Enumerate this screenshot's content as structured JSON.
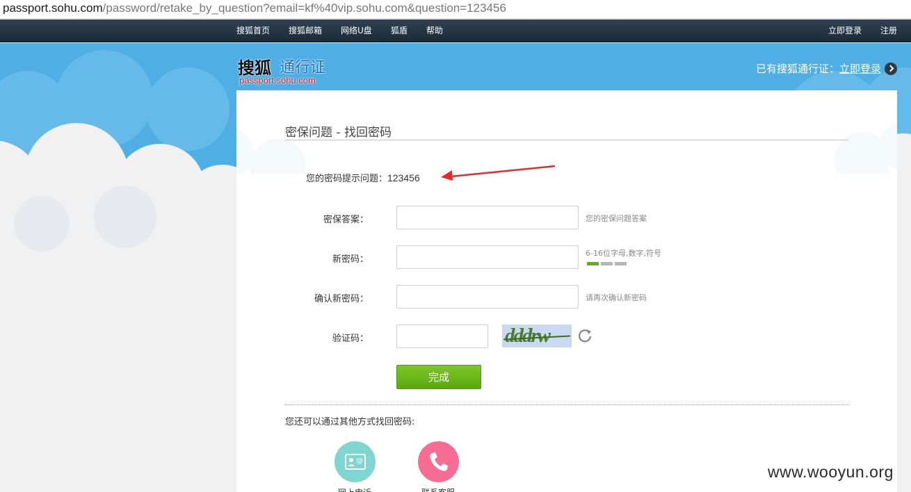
{
  "browser": {
    "url_host": "passport.sohu.com",
    "url_path": "/password/retake_by_question?email=kf%40vip.sohu.com&question=123456"
  },
  "topnav": {
    "left_items": [
      "搜狐首页",
      "搜狐邮箱",
      "网络U盘",
      "狐盾",
      "帮助"
    ],
    "login": "立即登录",
    "register": "注册"
  },
  "header": {
    "logo_cn_1": "搜狐",
    "logo_cn_2": "通行证",
    "logo_en": "passport.sohu.com",
    "has_account": "已有搜狐通行证：",
    "login_link": "立即登录"
  },
  "form": {
    "title": "密保问题 - 找回密码",
    "hint_label": "您的密码提示问题：",
    "hint_question": "123456",
    "answer_label": "密保答案：",
    "answer_tip": "您的密保问题答案",
    "answer_value": "",
    "new_password_label": "新密码：",
    "new_password_tip": "6-16位字母,数字,符号",
    "new_password_value": "",
    "confirm_label": "确认新密码：",
    "confirm_tip": "请再次确认新密码",
    "confirm_value": "",
    "captcha_label": "验证码：",
    "captcha_value": "",
    "captcha_text": "dddrw",
    "submit_label": "完成",
    "password_strength_level": 1,
    "password_strength_max": 3
  },
  "alternatives": {
    "heading": "您还可以通过其他方式找回密码:",
    "items": [
      "网上申诉",
      "联系客服"
    ]
  },
  "watermark": "www.wooyun.org",
  "colors": {
    "nav_bg": "#1f2e3a",
    "sky": "#4faee4",
    "submit_green": "#6bb81b",
    "circle_teal": "#7fd5cf",
    "circle_pink": "#f76c93",
    "hint_arrow": "#e52a2a"
  }
}
